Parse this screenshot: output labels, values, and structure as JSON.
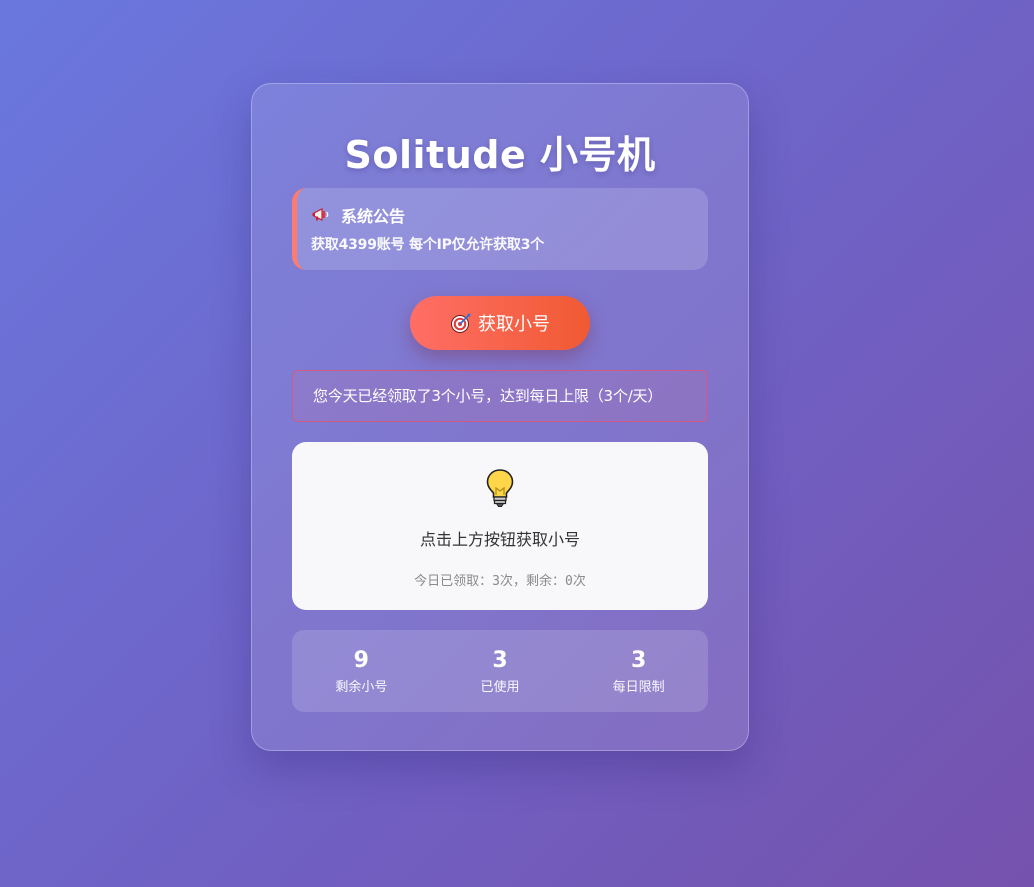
{
  "app": {
    "title": "Solitude 小号机"
  },
  "notice": {
    "icon": "megaphone-icon",
    "title": "系统公告",
    "text": "获取4399账号 每个IP仅允许获取3个",
    "accent_color": "#ff7a6f"
  },
  "action": {
    "icon": "target-icon",
    "button_label": "获取小号",
    "gradient_start": "#ff6e66",
    "gradient_end": "#f05a32"
  },
  "limit_message": "您今天已经领取了3个小号，达到每日上限（3个/天）",
  "result": {
    "icon": "lightbulb-icon",
    "hint": "点击上方按钮获取小号",
    "sub": "今日已领取：3次，剩余：0次"
  },
  "stats": [
    {
      "value": "9",
      "label": "剩余小号"
    },
    {
      "value": "3",
      "label": "已使用"
    },
    {
      "value": "3",
      "label": "每日限制"
    }
  ]
}
